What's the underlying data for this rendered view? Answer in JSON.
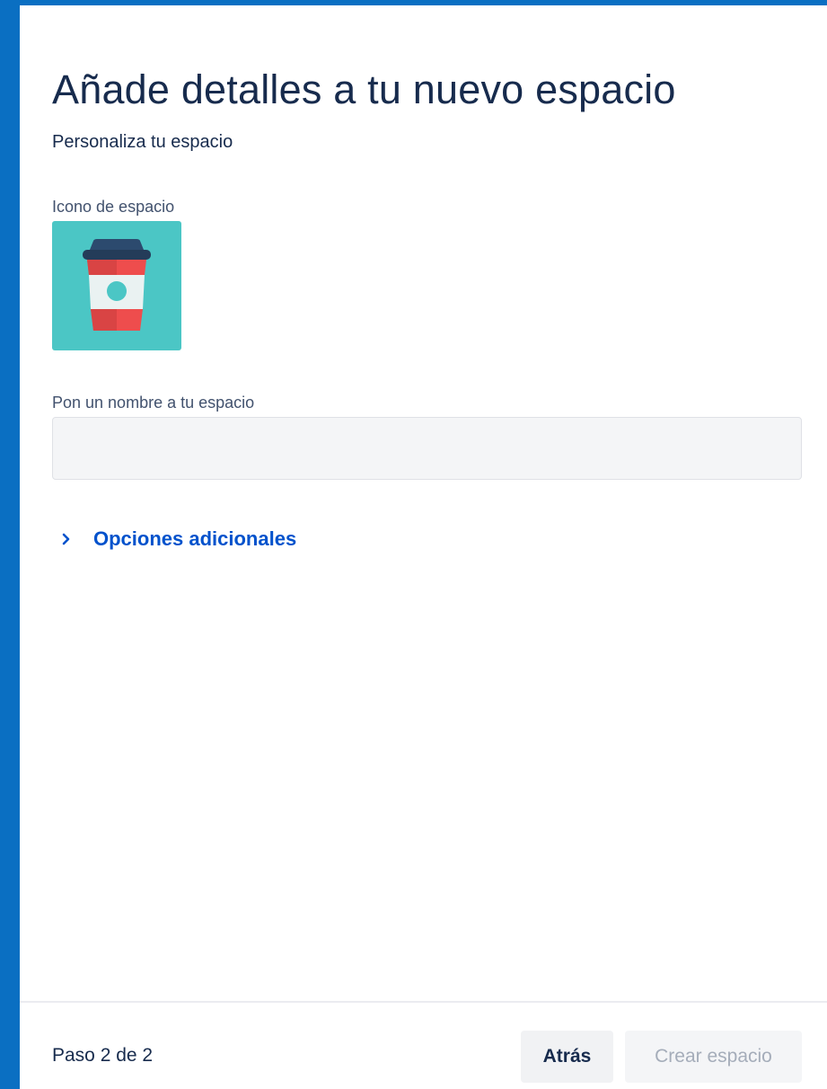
{
  "header": {
    "title": "Añade detalles a tu nuevo espacio",
    "subtitle": "Personaliza tu espacio"
  },
  "icon_field": {
    "label": "Icono de espacio",
    "icon_name": "coffee-cup-icon",
    "background_color": "#4bc6c5"
  },
  "name_field": {
    "label": "Pon un nombre a tu espacio",
    "value": "",
    "placeholder": ""
  },
  "more_options": {
    "label": "Opciones adicionales",
    "expanded": false,
    "icon_name": "chevron-right-icon"
  },
  "footer": {
    "step_text": "Paso 2 de 2",
    "back_label": "Atrás",
    "create_label": "Crear espacio",
    "create_enabled": false
  },
  "colors": {
    "frame": "#0a6fc2",
    "title_text": "#172b4d",
    "link": "#0052cc",
    "disabled_text": "#a5adba"
  }
}
